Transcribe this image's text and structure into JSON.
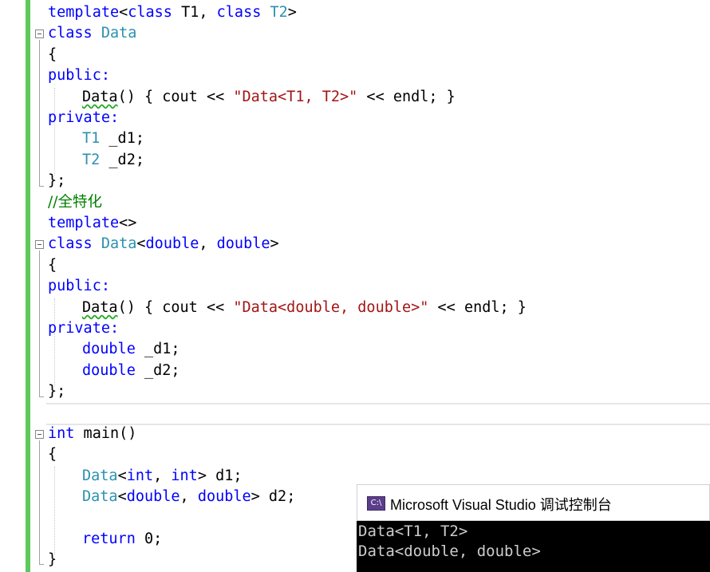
{
  "editor": {
    "lines": {
      "l1a": "template",
      "l1b": "<",
      "l1c": "class",
      "l1d": " T1, ",
      "l1e": "class",
      "l1f": " T2",
      "l1g": ">",
      "l2a": "class",
      "l2b": " Data",
      "l3": "{",
      "l4": "public:",
      "l5a": "Data",
      "l5b": "() { cout << ",
      "l5c": "\"Data<T1, T2>\"",
      "l5d": " << endl; }",
      "l6": "private:",
      "l7a": "T1",
      "l7b": " _d1;",
      "l8a": "T2",
      "l8b": " _d2;",
      "l9": "};",
      "l10": "//全特化",
      "l11a": "template",
      "l11b": "<>",
      "l12a": "class",
      "l12b": " Data",
      "l12c": "<",
      "l12d": "double",
      "l12e": ", ",
      "l12f": "double",
      "l12g": ">",
      "l13": "{",
      "l14": "public:",
      "l15a": "Data",
      "l15b": "() { cout << ",
      "l15c": "\"Data<double, double>\"",
      "l15d": " << endl; }",
      "l16": "private:",
      "l17a": "double",
      "l17b": " _d1;",
      "l18a": "double",
      "l18b": " _d2;",
      "l19": "};",
      "l21a": "int",
      "l21b": " main()",
      "l22": "{",
      "l23a": "Data",
      "l23b": "<",
      "l23c": "int",
      "l23d": ", ",
      "l23e": "int",
      "l23f": "> d1;",
      "l24a": "Data",
      "l24b": "<",
      "l24c": "double",
      "l24d": ", ",
      "l24e": "double",
      "l24f": "> d2;",
      "l26a": "return",
      "l26b": " 0;",
      "l27": "}"
    }
  },
  "console": {
    "icon_text": "C:\\",
    "title": "Microsoft Visual Studio 调试控制台",
    "output": [
      "Data<T1, T2>",
      "Data<double, double>"
    ]
  },
  "colors": {
    "keyword": "#0000ff",
    "type": "#2b91af",
    "string": "#a31515",
    "comment": "#008000",
    "change_bar": "#5cc95c",
    "console_bg": "#000000",
    "console_text": "#cccccc"
  }
}
